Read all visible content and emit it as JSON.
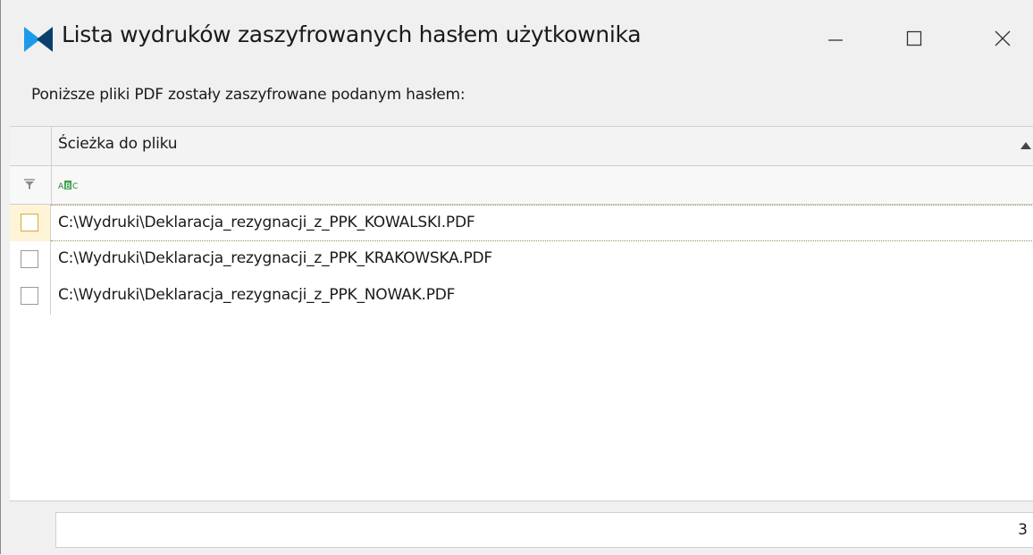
{
  "window": {
    "title": "Lista wydruków zaszyfrowanych hasłem użytkownika",
    "icon": "comarch-logo-icon",
    "accent_color": "#1e9be8"
  },
  "description": "Poniższe pliki PDF zostały zaszyfrowane podanym hasłem:",
  "grid": {
    "columns": [
      {
        "label": "Ścieżka do pliku",
        "sort": "ascending"
      }
    ],
    "filter_row": {
      "filter_icon": "filter-icon",
      "text_filter_icon": "abc-text-filter-icon"
    },
    "rows": [
      {
        "path": "C:\\Wydruki\\Deklaracja_rezygnacji_z_PPK_KOWALSKI.PDF",
        "checked": false,
        "active": true
      },
      {
        "path": "C:\\Wydruki\\Deklaracja_rezygnacji_z_PPK_KRAKOWSKA.PDF",
        "checked": false,
        "active": false
      },
      {
        "path": "C:\\Wydruki\\Deklaracja_rezygnacji_z_PPK_NOWAK.PDF",
        "checked": false,
        "active": false
      }
    ]
  },
  "footer": {
    "count": "3"
  },
  "colors": {
    "active_row_highlight": "#fff4d6",
    "active_checkbox_border": "#d9a93a"
  }
}
